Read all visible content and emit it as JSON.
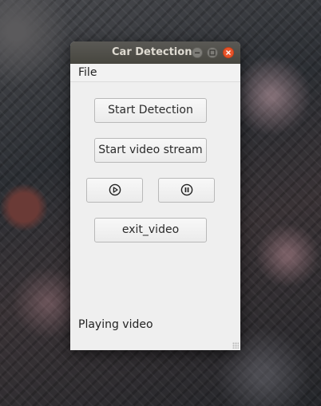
{
  "window": {
    "title": "Car Detection"
  },
  "titlebar_buttons": {
    "minimize_icon": "minimize-icon",
    "maximize_icon": "maximize-icon",
    "close_icon": "close-icon",
    "close_color": "#e9542a"
  },
  "menubar": {
    "file_label": "File"
  },
  "buttons": {
    "start_detection_label": "Start Detection",
    "start_stream_label": "Start video stream",
    "play_icon": "play-icon",
    "pause_icon": "pause-icon",
    "exit_label": "exit_video"
  },
  "status": {
    "text": "Playing video"
  }
}
